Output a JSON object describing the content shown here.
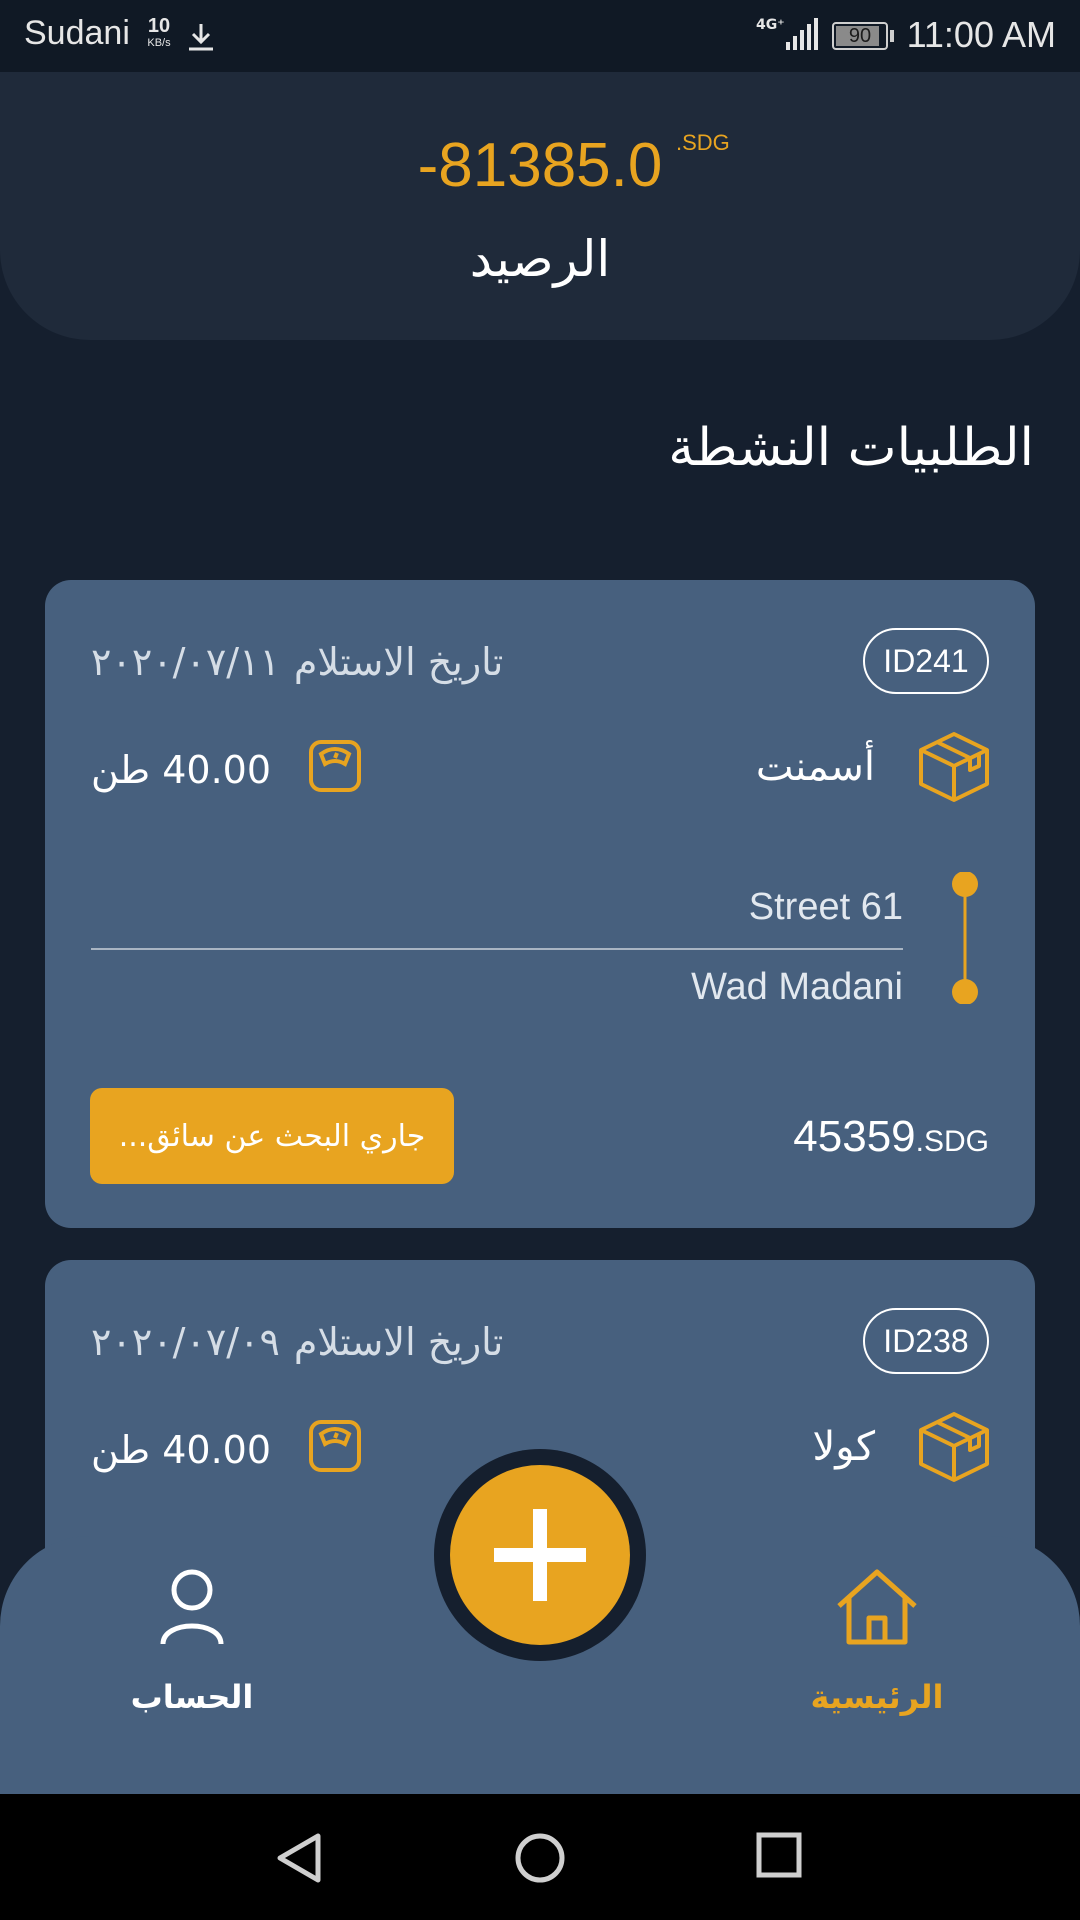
{
  "status_bar": {
    "carrier": "Sudani",
    "speed_value": "10",
    "speed_unit": "KB/s",
    "network": "4G⁺",
    "battery": "90",
    "time": "11:00 AM",
    "icons": [
      "download-icon",
      "signal-icon",
      "battery-icon"
    ]
  },
  "balance": {
    "amount": "-81385.0",
    "currency": ".SDG",
    "label": "الرصيد"
  },
  "section_title": "الطلبيات النشطة",
  "orders": [
    {
      "id": "ID241",
      "pickup_label": "تاريخ الاستلام",
      "pickup_date": "٢٠٢٠/٠٧/١١",
      "cargo": "أسمنت",
      "weight": "40.00 طن",
      "route_from": "Street 61",
      "route_to": "Wad Madani",
      "status_button": "جاري البحث عن سائق...",
      "price": "45359",
      "price_currency": ".SDG"
    },
    {
      "id": "ID238",
      "pickup_label": "تاريخ الاستلام",
      "pickup_date": "٢٠٢٠/٠٧/٠٩",
      "cargo": "كولا",
      "weight": "40.00 طن"
    }
  ],
  "bottom_nav": {
    "home_label": "الرئيسية",
    "account_label": "الحساب",
    "active": "home"
  },
  "colors": {
    "accent": "#e8a420",
    "background": "#151f2e",
    "header": "#1f2a3a",
    "card": "#47607e"
  }
}
